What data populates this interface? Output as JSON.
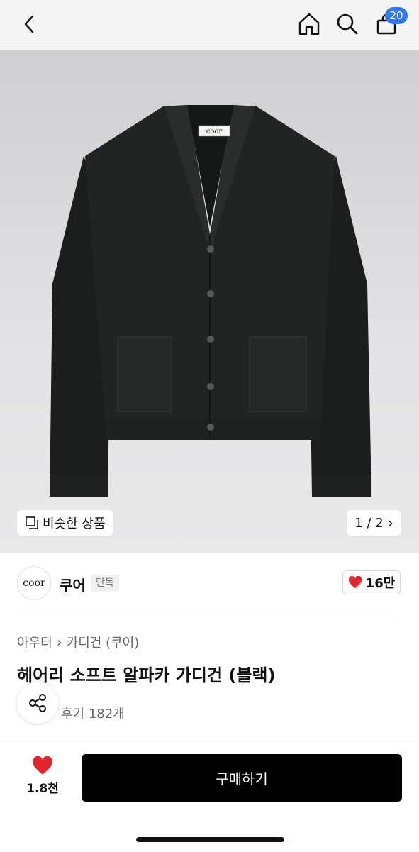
{
  "header": {
    "cart_count": "20"
  },
  "product": {
    "brand_tag": "coor",
    "similar_label": "비슷한 상품",
    "pager": "1 / 2",
    "pager_chevron": "›"
  },
  "seller": {
    "logo_text": "coor",
    "name": "쿠어",
    "badge": "단독",
    "likes": "16만"
  },
  "breadcrumb": {
    "category": "아우터",
    "separator": "›",
    "subcategory": "카디건 (쿠어)"
  },
  "title": "헤어리 소프트 알파카 가디건 (블랙)",
  "reviews": "후기 182개",
  "bottom": {
    "wish_count": "1.8천",
    "buy_label": "구매하기"
  },
  "colors": {
    "heart": "#e4262c",
    "badge": "#3478f6",
    "buy_bg": "#000000"
  }
}
